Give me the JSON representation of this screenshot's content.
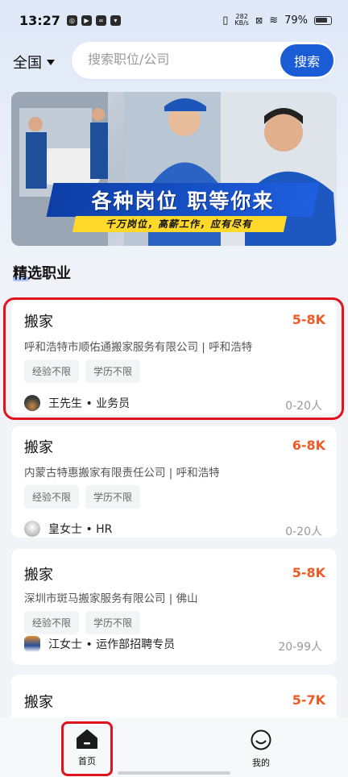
{
  "status_bar": {
    "time": "13:27",
    "net_speed_value": "282",
    "net_speed_unit": "KB/s",
    "battery": "79%"
  },
  "search": {
    "city": "全国",
    "placeholder": "搜索职位/公司",
    "button_label": "搜索"
  },
  "banner": {
    "title": "各种岗位 职等你来",
    "subtitle": "千万岗位，高薪工作，应有尽有"
  },
  "section_title": "精选职业",
  "jobs": [
    {
      "title": "搬家",
      "salary": "5-8K",
      "company": "呼和浩特市顺佑通搬家服务有限公司 | 呼和浩特",
      "tags": [
        "经验不限",
        "学历不限"
      ],
      "recruiter": "王先生 • 业务员",
      "size": "0-20人"
    },
    {
      "title": "搬家",
      "salary": "6-8K",
      "company": "内蒙古特惠搬家有限责任公司 | 呼和浩特",
      "tags": [
        "经验不限",
        "学历不限"
      ],
      "recruiter": "皇女士 • HR",
      "size": "0-20人"
    },
    {
      "title": "搬家",
      "salary": "5-8K",
      "company": "深圳市斑马搬家服务有限公司 | 佛山",
      "tags": [
        "经验不限",
        "学历不限"
      ],
      "recruiter": "江女士 • 运作部招聘专员",
      "size": "20-99人"
    },
    {
      "title": "搬家",
      "salary": "5-7K",
      "company": "",
      "tags": [],
      "recruiter": "",
      "size": ""
    }
  ],
  "bottom_nav": {
    "home_label": "首页",
    "mine_label": "我的"
  },
  "colors": {
    "accent_blue": "#1a5bd6",
    "salary_orange": "#ee5a24",
    "highlight_red": "#e0141e"
  }
}
